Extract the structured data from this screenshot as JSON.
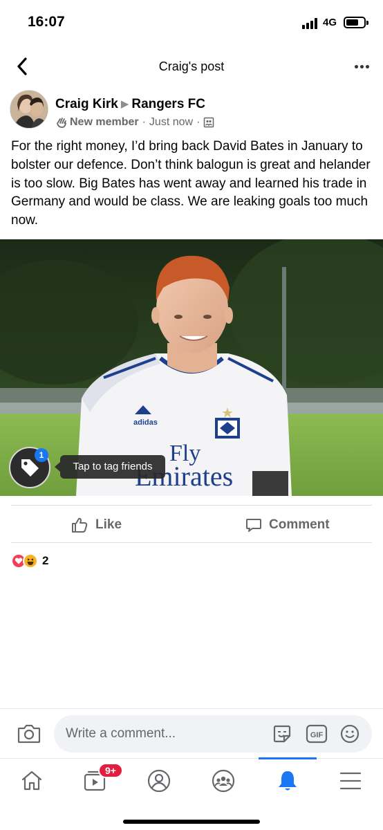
{
  "status": {
    "time": "16:07",
    "network": "4G"
  },
  "header": {
    "title": "Craig's post"
  },
  "post": {
    "author": "Craig Kirk",
    "group": "Rangers FC",
    "badge": "New member",
    "time": "Just now",
    "separator": "·",
    "text": "For the right money, I’d bring  back David Bates in January to bolster our defence. Don’t think balogun is great and  helander is too slow. Big Bates has went away and learned his trade in Germany and would be class. We are leaking goals too much now.",
    "image": {
      "jersey_text_1": "Fly",
      "jersey_text_2": "Emirates",
      "brand_text": "adidas",
      "tag_count": "1",
      "tag_tooltip": "Tap to tag friends"
    }
  },
  "actions": {
    "like": "Like",
    "comment": "Comment"
  },
  "reactions": {
    "count": "2",
    "icons": [
      "love-icon",
      "haha-icon"
    ]
  },
  "comment_bar": {
    "placeholder": "Write a comment..."
  },
  "nav": {
    "watch_badge": "9+",
    "items": [
      "home-icon",
      "watch-icon",
      "profile-icon",
      "groups-icon",
      "notifications-icon",
      "menu-icon"
    ],
    "active": "notifications-icon"
  },
  "colors": {
    "accent": "#1877f2",
    "badge_red": "#e41e3f",
    "secondary_text": "#65676b"
  }
}
